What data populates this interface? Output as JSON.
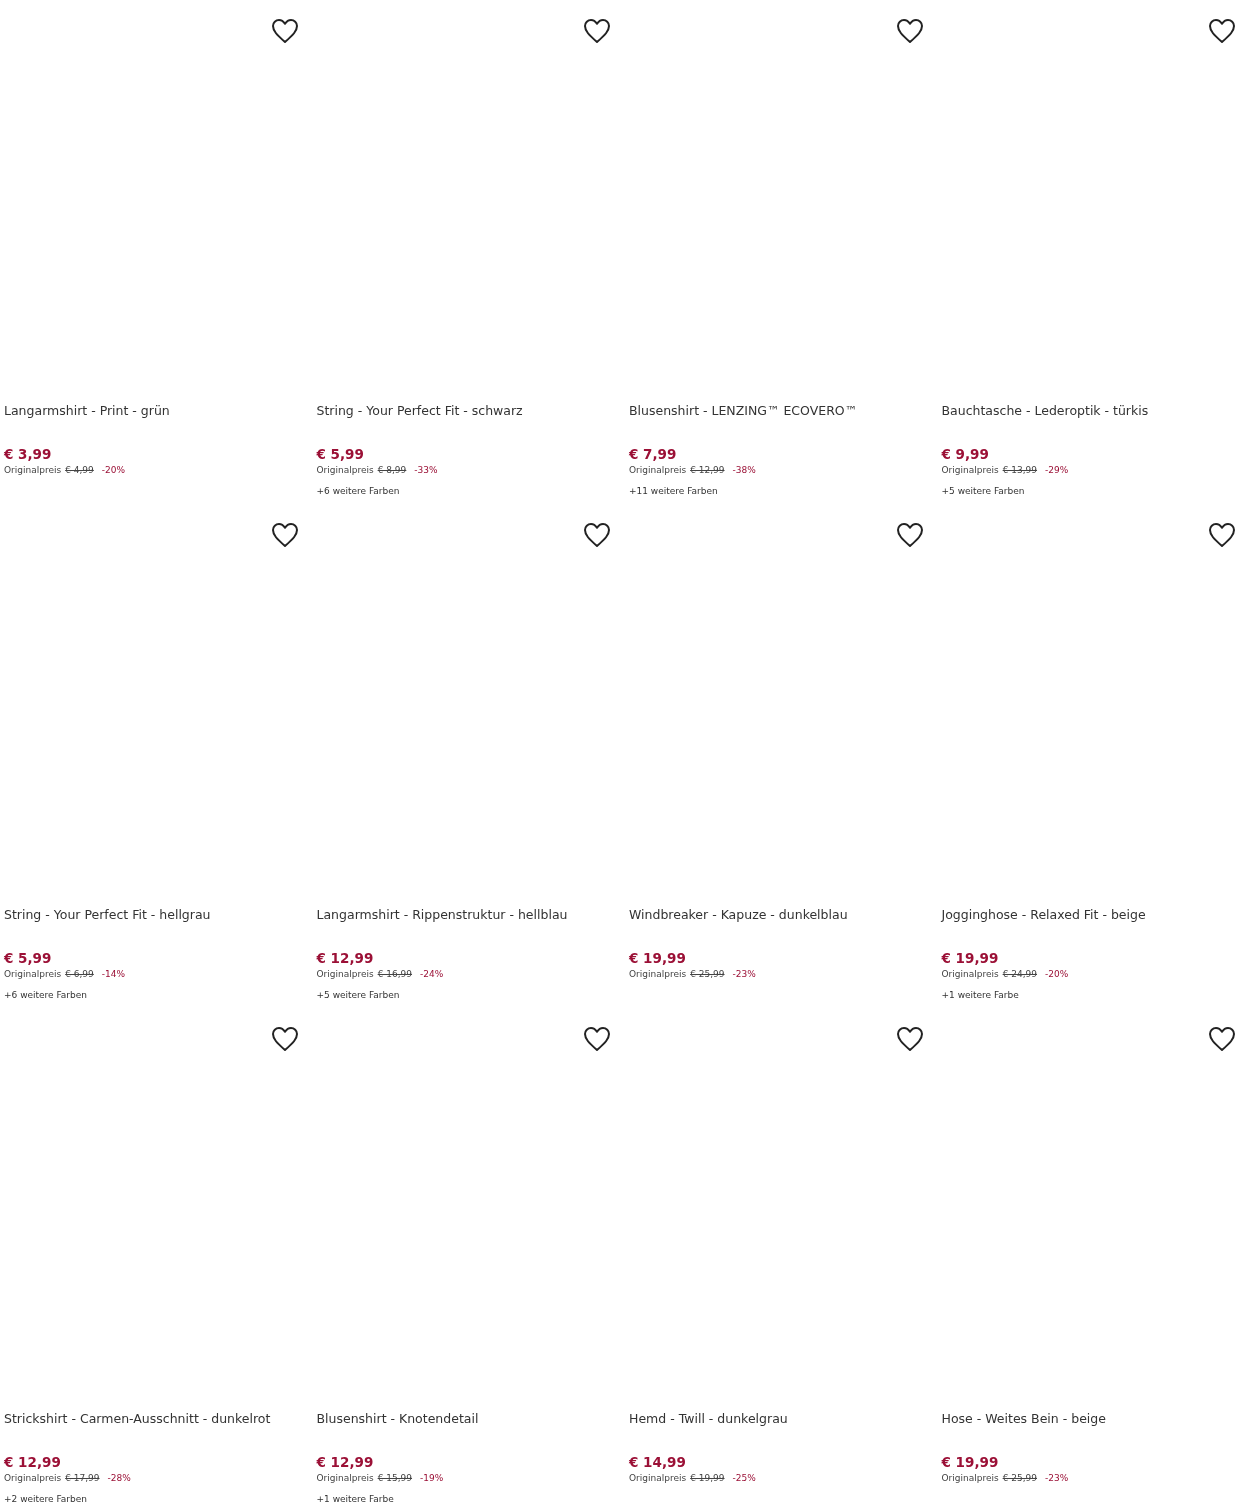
{
  "products": [
    {
      "title": "Langarmshirt - Print - grün",
      "price": "€ 3,99",
      "original_label": "Originalpreis",
      "original_price": "€ 4,99",
      "discount": "-20%",
      "wishlisted": false
    },
    {
      "title": "String - Your Perfect Fit - schwarz",
      "price": "€ 5,99",
      "original_label": "Originalpreis",
      "original_price": "€ 8,99",
      "discount": "-33%",
      "more_colors": "+6 weitere Farben",
      "wishlisted": false
    },
    {
      "title": "Blusenshirt - LENZING™ ECOVERO™",
      "price": "€ 7,99",
      "original_label": "Originalpreis",
      "original_price": "€ 12,99",
      "discount": "-38%",
      "more_colors": "+11 weitere Farben",
      "wishlisted": false
    },
    {
      "title": "Bauchtasche - Lederoptik - türkis",
      "price": "€ 9,99",
      "original_label": "Originalpreis",
      "original_price": "€ 13,99",
      "discount": "-29%",
      "more_colors": "+5 weitere Farben",
      "wishlisted": false
    },
    {
      "title": "String - Your Perfect Fit - hellgrau",
      "price": "€ 5,99",
      "original_label": "Originalpreis",
      "original_price": "€ 6,99",
      "discount": "-14%",
      "more_colors": "+6 weitere Farben",
      "wishlisted": false
    },
    {
      "title": "Langarmshirt - Rippenstruktur - hellblau",
      "price": "€ 12,99",
      "original_label": "Originalpreis",
      "original_price": "€ 16,99",
      "discount": "-24%",
      "more_colors": "+5 weitere Farben",
      "wishlisted": false
    },
    {
      "title": "Windbreaker - Kapuze - dunkelblau",
      "price": "€ 19,99",
      "original_label": "Originalpreis",
      "original_price": "€ 25,99",
      "discount": "-23%",
      "wishlisted": false
    },
    {
      "title": "Jogginghose - Relaxed Fit - beige",
      "price": "€ 19,99",
      "original_label": "Originalpreis",
      "original_price": "€ 24,99",
      "discount": "-20%",
      "more_colors": "+1 weitere Farbe",
      "wishlisted": false
    },
    {
      "title": "Strickshirt - Carmen-Ausschnitt - dunkelrot",
      "price": "€ 12,99",
      "original_label": "Originalpreis",
      "original_price": "€ 17,99",
      "discount": "-28%",
      "more_colors": "+2 weitere Farben",
      "wishlisted": false
    },
    {
      "title": "Blusenshirt - Knotendetail",
      "price": "€ 12,99",
      "original_label": "Originalpreis",
      "original_price": "€ 15,99",
      "discount": "-19%",
      "more_colors": "+1 weitere Farbe",
      "wishlisted": false
    },
    {
      "title": "Hemd - Twill - dunkelgrau",
      "price": "€ 14,99",
      "original_label": "Originalpreis",
      "original_price": "€ 19,99",
      "discount": "-25%",
      "wishlisted": false
    },
    {
      "title": "Hose - Weites Bein - beige",
      "price": "€ 19,99",
      "original_label": "Originalpreis",
      "original_price": "€ 25,99",
      "discount": "-23%",
      "wishlisted": false
    }
  ]
}
